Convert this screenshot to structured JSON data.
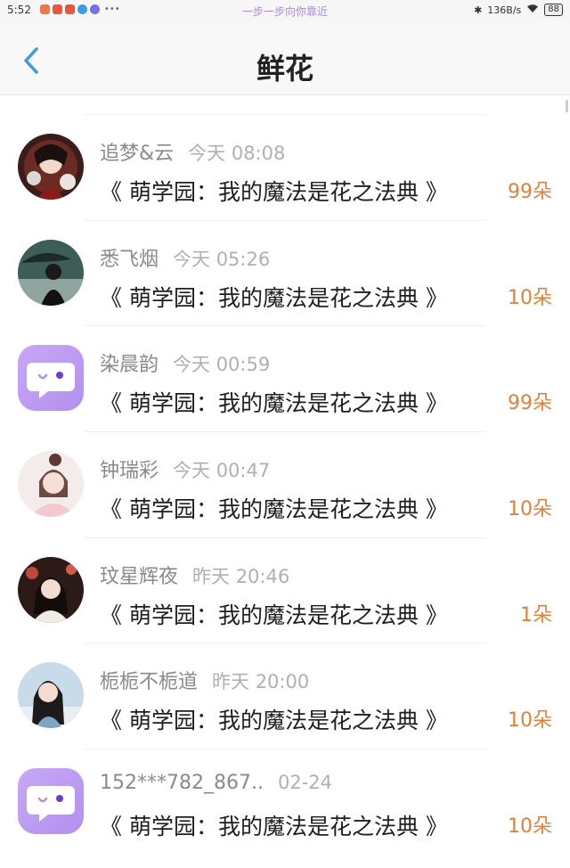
{
  "status_bar": {
    "time": "5:52",
    "center_text": "一步一步向你靠近",
    "network_speed": "136B/s",
    "battery": "88"
  },
  "header": {
    "title": "鲜花"
  },
  "items": [
    {
      "user": "追梦&云",
      "time": "今天 08:08",
      "book": "《 萌学园：我的魔法是花之法典 》",
      "count": "99朵"
    },
    {
      "user": "悉飞烟",
      "time": "今天 05:26",
      "book": "《 萌学园：我的魔法是花之法典 》",
      "count": "10朵"
    },
    {
      "user": "染晨韵",
      "time": "今天 00:59",
      "book": "《 萌学园：我的魔法是花之法典 》",
      "count": "99朵"
    },
    {
      "user": "钟瑞彩",
      "time": "今天 00:47",
      "book": "《 萌学园：我的魔法是花之法典 》",
      "count": "10朵"
    },
    {
      "user": "玟星辉夜",
      "time": "昨天 20:46",
      "book": "《 萌学园：我的魔法是花之法典 》",
      "count": "1朵"
    },
    {
      "user": "栀栀不栀道",
      "time": "昨天 20:00",
      "book": "《 萌学园：我的魔法是花之法典 》",
      "count": "10朵"
    },
    {
      "user": "152***782_867..",
      "time": "02-24",
      "book": "《 萌学园：我的魔法是花之法典 》",
      "count": "10朵"
    }
  ]
}
